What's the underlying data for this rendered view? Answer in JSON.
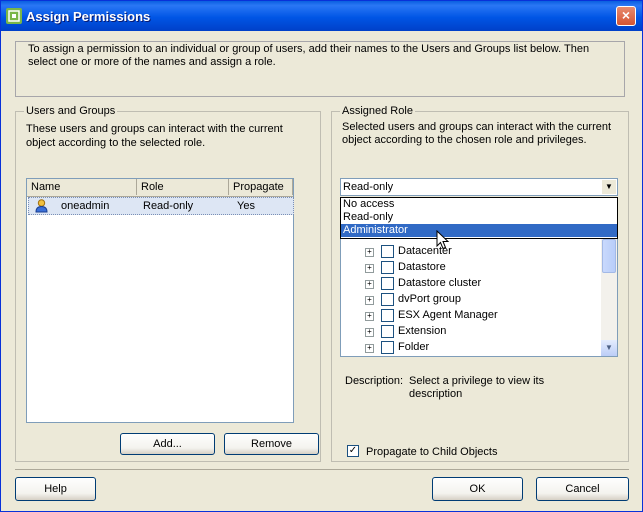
{
  "window": {
    "title": "Assign Permissions",
    "close": "×"
  },
  "intro": "To assign a permission to an individual or group of users, add their names to the Users and Groups list below. Then select one or more of the names and assign a role.",
  "users_groups": {
    "title": "Users and Groups",
    "description": "These users and groups can interact with the current object according to the selected role.",
    "columns": [
      "Name",
      "Role",
      "Propagate"
    ],
    "rows": [
      {
        "name": "oneadmin",
        "role": "Read-only",
        "propagate": "Yes"
      }
    ],
    "add_label": "Add...",
    "remove_label": "Remove"
  },
  "assigned_role": {
    "title": "Assigned Role",
    "description": "Selected users and groups can interact with the current object according to the chosen role and privileges.",
    "selected": "Read-only",
    "options": [
      "No access",
      "Read-only",
      "Administrator"
    ],
    "highlighted": "Administrator",
    "privileges": [
      "Datacenter",
      "Datastore",
      "Datastore cluster",
      "dvPort group",
      "ESX Agent Manager",
      "Extension",
      "Folder"
    ],
    "description_label": "Description:",
    "description_text": "Select a privilege to view its description",
    "propagate_label": "Propagate to Child Objects",
    "propagate_checked": true
  },
  "footer": {
    "help": "Help",
    "ok": "OK",
    "cancel": "Cancel"
  }
}
